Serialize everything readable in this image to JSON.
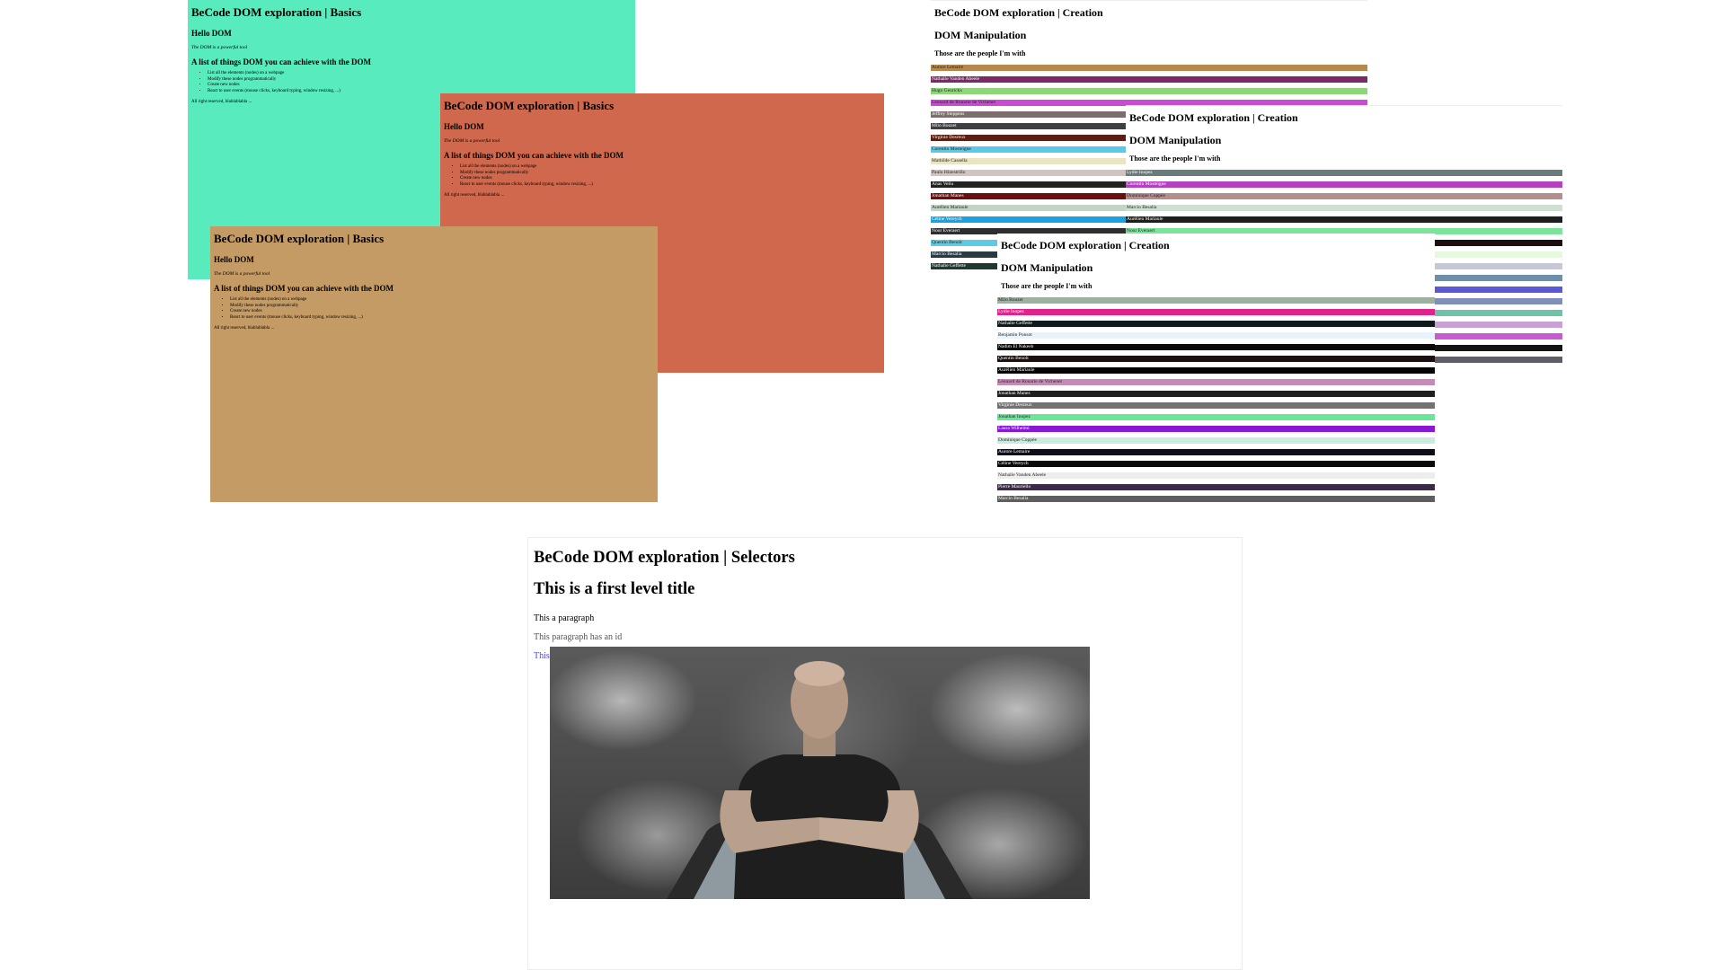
{
  "basics": {
    "title": "BeCode DOM exploration | Basics",
    "hello": "Hello DOM",
    "intro": "The DOM is a powerful tool",
    "subtitle": "A list of things DOM you can achieve with the DOM",
    "items": [
      "List all the elements (nodes) on a webpage",
      "Modify these nodes programmatically",
      "Create new nodes",
      "React to user events (mouse clicks, keyboard typing, window resizing, ...)"
    ],
    "footer": "All right reserved, blablablabla ...",
    "colors": [
      "#57ebbd",
      "#cf684c",
      "#c49a65"
    ]
  },
  "creation": {
    "title": "BeCode DOM exploration | Creation",
    "manipulation": "DOM Manipulation",
    "people_heading": "Those are the people I'm with",
    "window1_rows": [
      {
        "name": "Aurore Lemaire",
        "color": "#b7884d",
        "text": "light"
      },
      {
        "name": "Nathalie Vanden Abeele",
        "color": "#7a2a67",
        "text": "dark"
      },
      {
        "name": "Hugo Geurickx",
        "color": "#8fd67a",
        "text": "light"
      },
      {
        "name": "Léonard de Rouarie de Vichenet",
        "color": "#c94bd1",
        "text": "light"
      },
      {
        "name": "Jeffrey Steppens",
        "color": "#7b6e6c",
        "text": "dark"
      },
      {
        "name": "Milo Bouzet",
        "color": "#3f3f3f",
        "text": "dark"
      },
      {
        "name": "Virginie Desreux",
        "color": "#5a1e14",
        "text": "dark"
      },
      {
        "name": "Corentin Mosteigne",
        "color": "#5ac8e6",
        "text": "light"
      },
      {
        "name": "Mathilde Cassella",
        "color": "#e8e4c4",
        "text": "light"
      },
      {
        "name": "Paulo Hinestrillo",
        "color": "#d3c3be",
        "text": "light"
      },
      {
        "name": "Anas Veliu",
        "color": "#222222",
        "text": "dark"
      },
      {
        "name": "Jonathan Manes",
        "color": "#6a0f0f",
        "text": "dark"
      },
      {
        "name": "Aurélien Mariaule",
        "color": "#c3d3c4",
        "text": "light"
      },
      {
        "name": "Céline Vereych",
        "color": "#1aa1e0",
        "text": "dark"
      },
      {
        "name": "Nour Everaert",
        "color": "#2e2e2e",
        "text": "dark"
      },
      {
        "name": "Quentin Benoit",
        "color": "#5ecbe6",
        "text": "light"
      },
      {
        "name": "Marcio Besalia",
        "color": "#2a3a40",
        "text": "dark"
      },
      {
        "name": "Nathalie Geffette",
        "color": "#213a30",
        "text": "dark"
      }
    ],
    "window2_rows": [
      {
        "name": "Lydie Inopez",
        "color": "#6a7b7c",
        "text": "dark"
      },
      {
        "name": "Corentin Mosteigne",
        "color": "#b540c0",
        "text": "dark"
      },
      {
        "name": "Dominique Coppée",
        "color": "#b48e8e",
        "text": "light"
      },
      {
        "name": "Marcio Besalia",
        "color": "#cfe0d2",
        "text": "light"
      },
      {
        "name": "Aurélien Mariaule",
        "color": "#1e1e1e",
        "text": "dark"
      },
      {
        "name": "Nour Everaert",
        "color": "#7be39a",
        "text": "light"
      },
      {
        "name": "",
        "color": "#1e0f0f",
        "text": "dark"
      },
      {
        "name": "",
        "color": "#e6f9de",
        "text": "light"
      },
      {
        "name": "",
        "color": "#c6c8d8",
        "text": "light"
      },
      {
        "name": "",
        "color": "#6f8fa8",
        "text": "dark"
      },
      {
        "name": "",
        "color": "#5a5ad6",
        "text": "dark"
      },
      {
        "name": "",
        "color": "#7f8fb8",
        "text": "dark"
      },
      {
        "name": "",
        "color": "#6cc3a8",
        "text": "light"
      },
      {
        "name": "",
        "color": "#c8a0d6",
        "text": "light"
      },
      {
        "name": "",
        "color": "#c95bd1",
        "text": "dark"
      },
      {
        "name": "",
        "color": "#141414",
        "text": "dark"
      },
      {
        "name": "",
        "color": "#5e5f66",
        "text": "dark"
      }
    ],
    "window3_rows": [
      {
        "name": "Milo Bouzet",
        "color": "#9cb29e",
        "text": "light"
      },
      {
        "name": "Lydie Inopez",
        "color": "#e0238a",
        "text": "dark"
      },
      {
        "name": "Nathalie Geffette",
        "color": "#0f1a1c",
        "text": "dark"
      },
      {
        "name": "Benjamin Ponsot",
        "color": "#e8f3fb",
        "text": "light"
      },
      {
        "name": "Nadim El Nakeeb",
        "color": "#0a0a0a",
        "text": "dark"
      },
      {
        "name": "Quentin Benoit",
        "color": "#1a1210",
        "text": "dark"
      },
      {
        "name": "Aurélien Mariaule",
        "color": "#050505",
        "text": "dark"
      },
      {
        "name": "Léonard de Rouarie de Vichenet",
        "color": "#c48cb4",
        "text": "light"
      },
      {
        "name": "Jonathan Manes",
        "color": "#1f1f1f",
        "text": "dark"
      },
      {
        "name": "Virginie Desreux",
        "color": "#727272",
        "text": "dark"
      },
      {
        "name": "Jonathan Inopez",
        "color": "#6ae59a",
        "text": "light"
      },
      {
        "name": "Laura Wilhelmi",
        "color": "#8a17d6",
        "text": "dark"
      },
      {
        "name": "Dominique Coppée",
        "color": "#c9ecdf",
        "text": "light"
      },
      {
        "name": "Aurore Lemaire",
        "color": "#0d0d1a",
        "text": "dark"
      },
      {
        "name": "Céline Vereych",
        "color": "#0a0a0a",
        "text": "dark"
      },
      {
        "name": "Nathalie Vanden Abeele",
        "color": "#ededed",
        "text": "light"
      },
      {
        "name": "Pierre Mauriello",
        "color": "#3d2a4a",
        "text": "dark"
      },
      {
        "name": "Marcio Besalia",
        "color": "#5e5e5e",
        "text": "dark"
      }
    ]
  },
  "selectors": {
    "title": "BeCode DOM exploration | Selectors",
    "first_level": "This is a first level title",
    "p1": "This a paragraph",
    "p2": "This paragraph has an id",
    "p3": "This paragraph is inside a div and is followed by an important image"
  }
}
